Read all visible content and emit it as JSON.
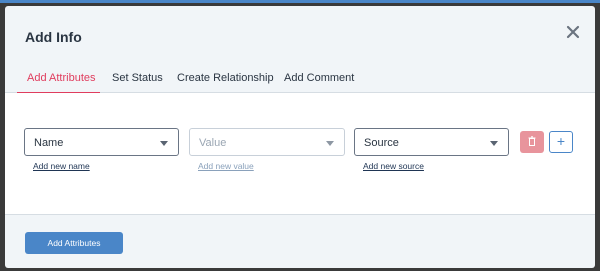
{
  "modal": {
    "title": "Add Info",
    "close_icon": "close-icon"
  },
  "tabs": [
    {
      "label": "Add Attributes",
      "active": true
    },
    {
      "label": "Set Status",
      "active": false
    },
    {
      "label": "Create Relationship",
      "active": false
    },
    {
      "label": "Add Comment",
      "active": false
    }
  ],
  "attribute_row": {
    "name_select": {
      "value": "Name",
      "link": "Add new name"
    },
    "value_select": {
      "value": "Value",
      "link": "Add new value"
    },
    "source_select": {
      "value": "Source",
      "link": "Add new source"
    },
    "delete_icon": "trash-icon",
    "add_icon": "plus-icon",
    "add_label": "+"
  },
  "footer": {
    "submit_label": "Add Attributes"
  },
  "colors": {
    "accent": "#e03d5e",
    "primary": "#4a86c8",
    "danger_disabled": "#e8949c"
  }
}
